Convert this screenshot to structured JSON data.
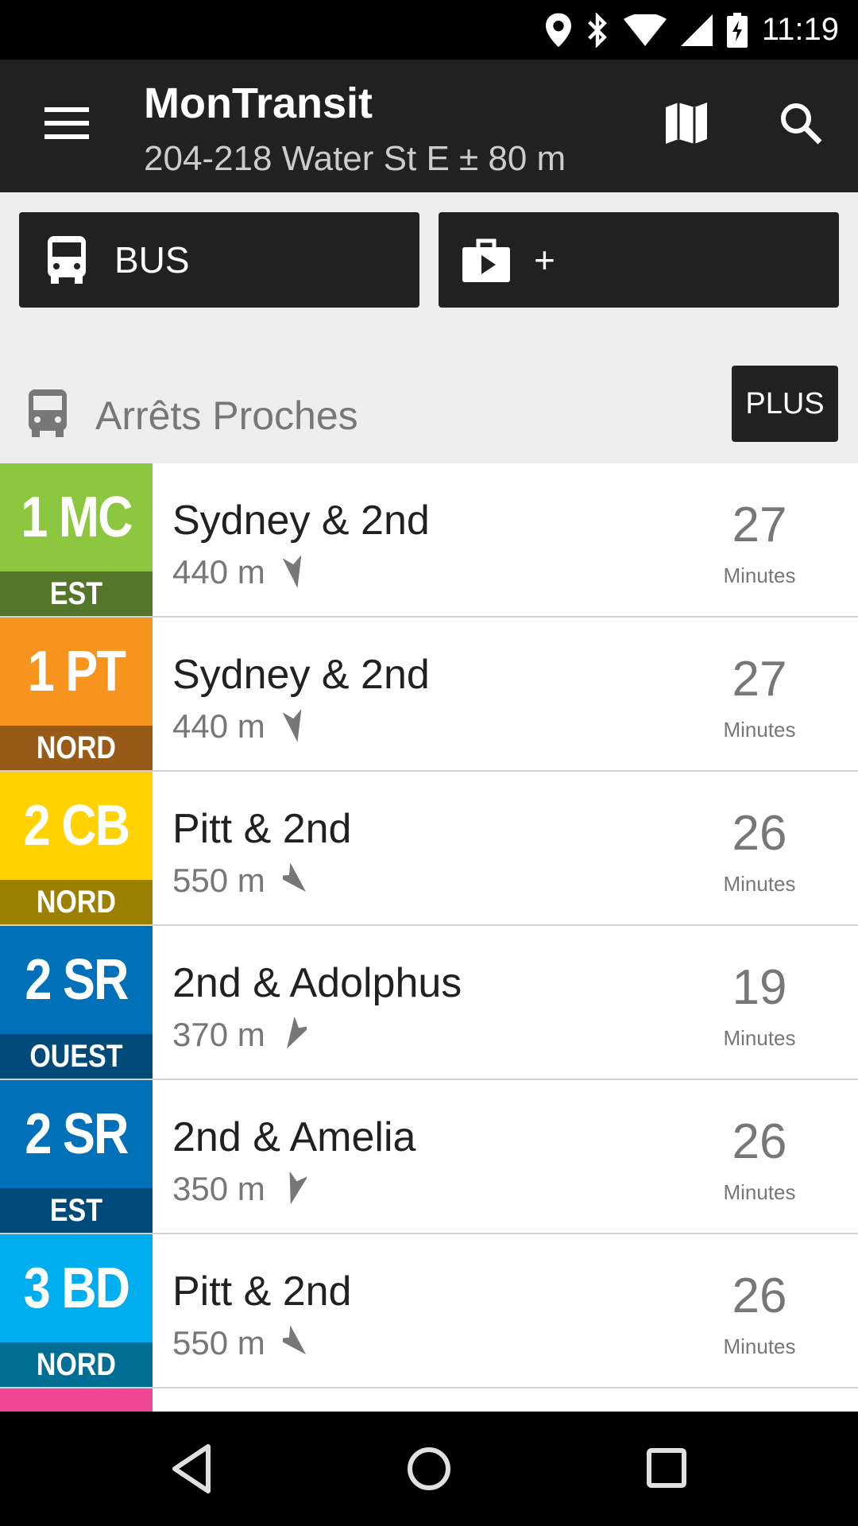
{
  "status_bar": {
    "time": "11:19"
  },
  "toolbar": {
    "title": "MonTransit",
    "subtitle": "204-218 Water St E ± 80 m"
  },
  "buttons": {
    "bus": "BUS",
    "add": "+"
  },
  "section": {
    "title": "Arrêts Proches",
    "more": "PLUS"
  },
  "stops": [
    {
      "route": "1 MC",
      "direction": "EST",
      "name": "Sydney & 2nd",
      "distance": "440 m",
      "minutes": "27",
      "minutes_label": "Minutes",
      "color": "#8DC63F",
      "dark": "#55752A",
      "bearing": 170
    },
    {
      "route": "1 PT",
      "direction": "NORD",
      "name": "Sydney & 2nd",
      "distance": "440 m",
      "minutes": "27",
      "minutes_label": "Minutes",
      "color": "#F7941D",
      "dark": "#975A17",
      "bearing": 170
    },
    {
      "route": "2 CB",
      "direction": "NORD",
      "name": "Pitt & 2nd",
      "distance": "550 m",
      "minutes": "26",
      "minutes_label": "Minutes",
      "color": "#FFD200",
      "dark": "#9C8100",
      "bearing": 135
    },
    {
      "route": "2 SR",
      "direction": "OUEST",
      "name": "2nd & Adolphus",
      "distance": "370 m",
      "minutes": "19",
      "minutes_label": "Minutes",
      "color": "#0070B8",
      "dark": "#004A7A",
      "bearing": 210
    },
    {
      "route": "2 SR",
      "direction": "EST",
      "name": "2nd & Amelia",
      "distance": "350 m",
      "minutes": "26",
      "minutes_label": "Minutes",
      "color": "#0070B8",
      "dark": "#004A7A",
      "bearing": 195
    },
    {
      "route": "3 BD",
      "direction": "NORD",
      "name": "Pitt & 2nd",
      "distance": "550 m",
      "minutes": "26",
      "minutes_label": "Minutes",
      "color": "#00AEEF",
      "dark": "#006D94",
      "bearing": 135
    }
  ],
  "partial_row_color": "#EE4596"
}
